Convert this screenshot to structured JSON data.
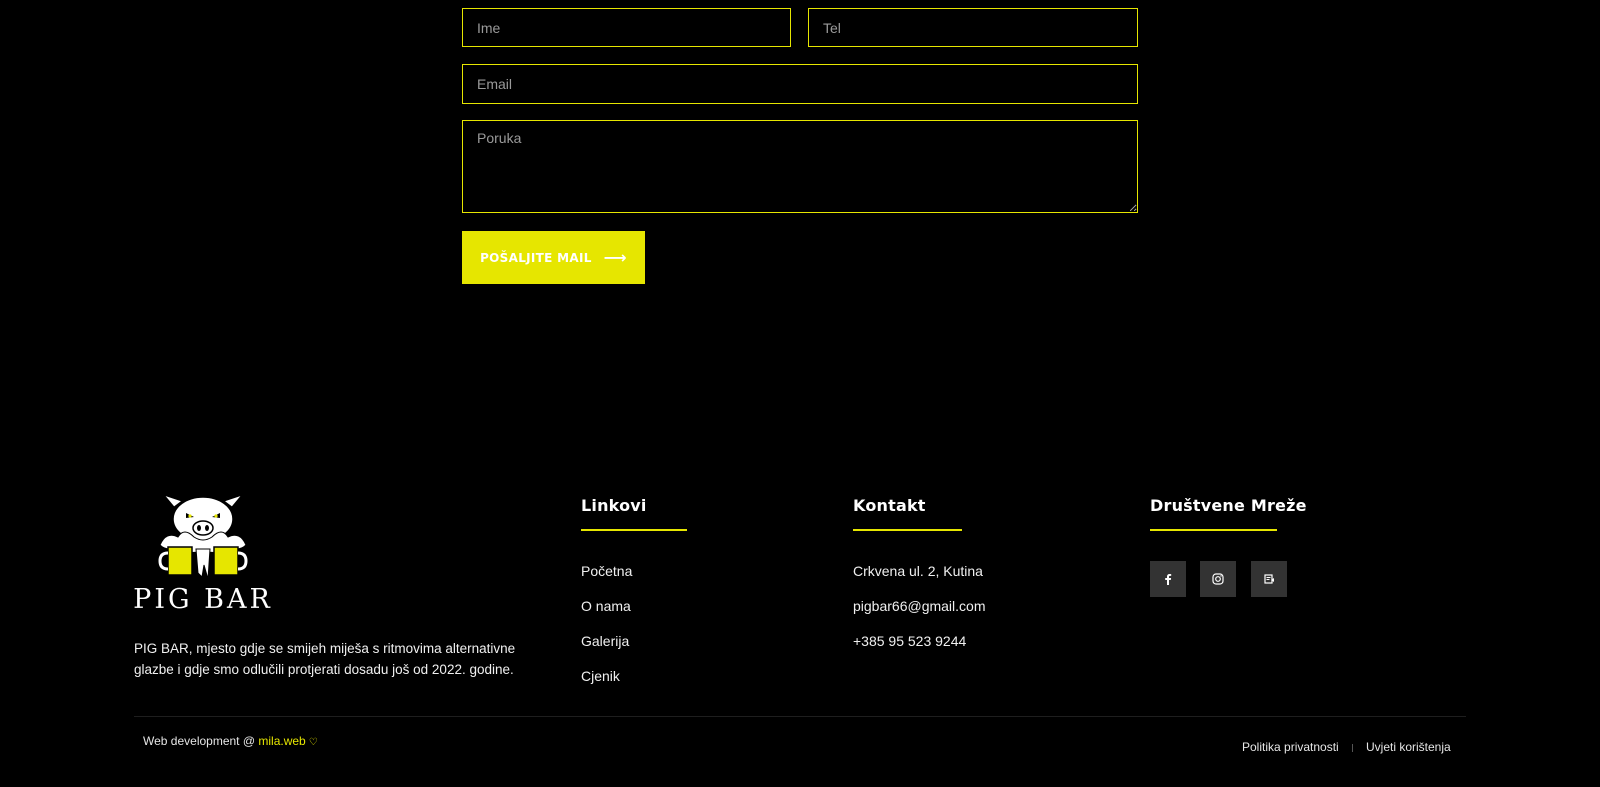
{
  "form": {
    "name_placeholder": "Ime",
    "tel_placeholder": "Tel",
    "email_placeholder": "Email",
    "message_placeholder": "Poruka",
    "submit_label": "POŠALJITE MAIL",
    "submit_icon": "arrow-right-icon"
  },
  "footer": {
    "logo_text": "PIG BAR",
    "about": "PIG BAR, mjesto gdje se smijeh miješa s ritmovima alternativne glazbe i gdje smo odlučili protjerati dosadu još od 2022. godine.",
    "links": {
      "title": "Linkovi",
      "items": [
        "Početna",
        "O nama",
        "Galerija",
        "Cjenik"
      ]
    },
    "contact": {
      "title": "Kontakt",
      "address": "Crkvena ul. 2, Kutina",
      "email": "pigbar66@gmail.com",
      "phone": "+385 95 523 9244"
    },
    "social": {
      "title": "Društvene Mreže",
      "icons": [
        "facebook-icon",
        "instagram-icon",
        "menu-card-icon"
      ]
    },
    "bottom": {
      "credit_prefix": "Web development @ ",
      "credit_brand": "mila.web",
      "privacy": "Politika privatnosti",
      "terms": "Uvjeti korištenja"
    }
  },
  "colors": {
    "accent": "#e6e600",
    "background": "#000000",
    "social_bg": "#333333"
  }
}
